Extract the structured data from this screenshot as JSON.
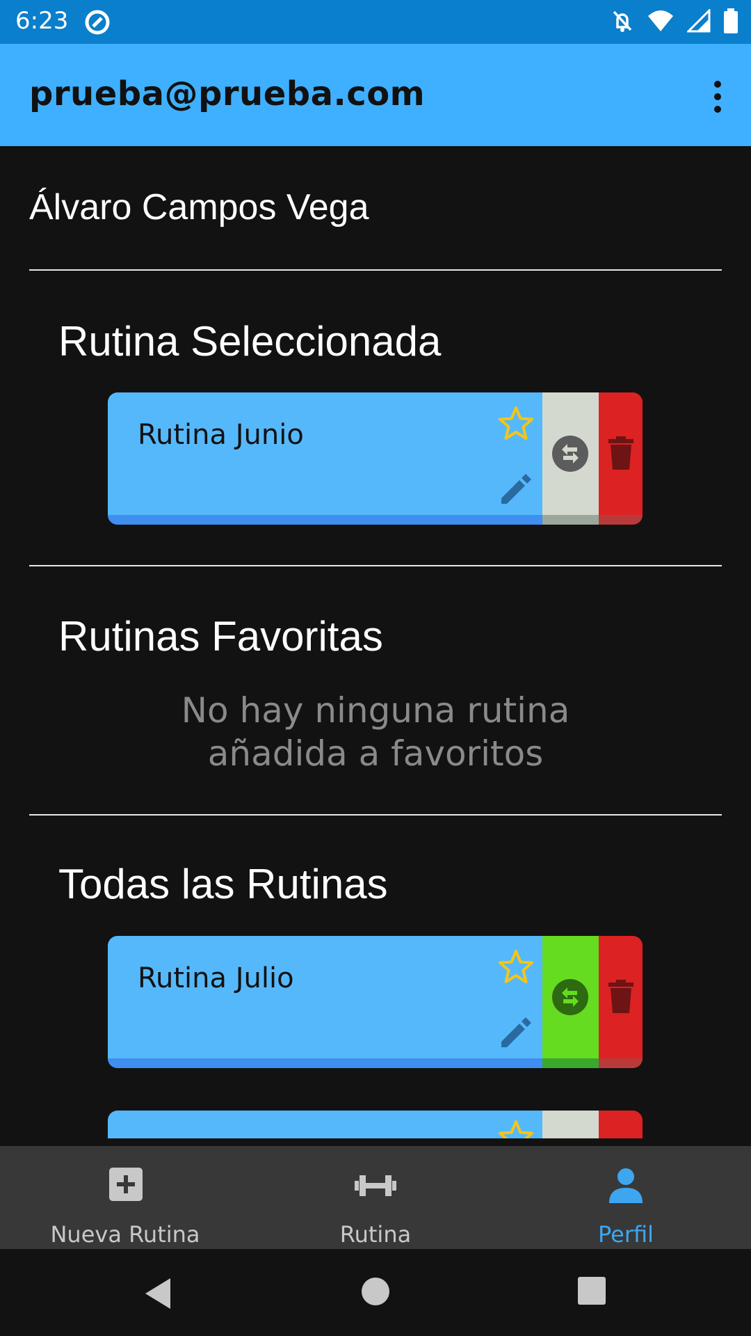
{
  "status_bar": {
    "time": "6:23"
  },
  "app_bar": {
    "title": "prueba@prueba.com"
  },
  "profile": {
    "user_name": "Álvaro Campos Vega"
  },
  "selected_section": {
    "title": "Rutina Seleccionada",
    "card": {
      "name": "Rutina Junio",
      "swap_color": "#d3d9ce",
      "swap_base": "#9aa79a",
      "icon_color": "#5c5c5c"
    }
  },
  "favorites_section": {
    "title": "Rutinas Favoritas",
    "empty_line1": "No hay ninguna rutina",
    "empty_line2": "añadida a favoritos"
  },
  "all_section": {
    "title": "Todas las Rutinas",
    "cards": [
      {
        "name": "Rutina Julio",
        "swap_color": "#65dc1f",
        "swap_base": "#3aa82a",
        "icon_color": "#2d6a12"
      }
    ]
  },
  "bottom_nav": {
    "items": [
      {
        "label": "Nueva Rutina",
        "icon": "add-box-icon",
        "active": false
      },
      {
        "label": "Rutina",
        "icon": "dumbbell-icon",
        "active": false
      },
      {
        "label": "Perfil",
        "icon": "person-icon",
        "active": true
      }
    ]
  },
  "colors": {
    "status_bar": "#0a7fcc",
    "app_bar": "#3fb0ff",
    "card": "#55b8fb",
    "delete": "#dc2222",
    "star": "#f5c518",
    "active_nav": "#3ea6f0"
  }
}
